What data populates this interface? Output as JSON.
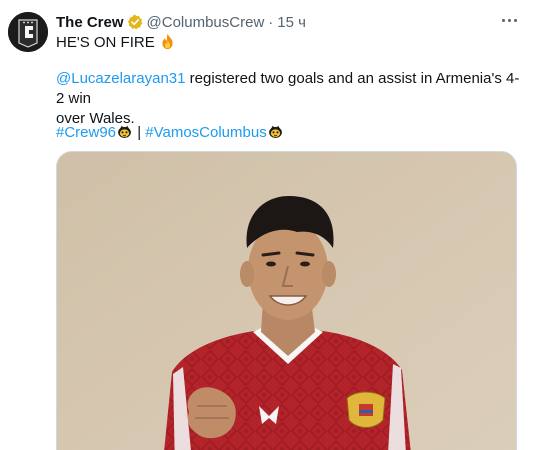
{
  "tweet": {
    "author": {
      "display_name": "The Crew",
      "handle": "@ColumbusCrew",
      "separator": "·",
      "time": "15 ч",
      "verified": true,
      "avatar_letter": "C"
    },
    "line1": "HE'S ON FIRE",
    "mention": "@Lucazelarayan31",
    "body_part1": " registered two goals and an assist in Armenia's 4-2 win",
    "body_part2": "over Wales.",
    "hashtag1": "#Crew96",
    "divider": " | ",
    "hashtag2": "#VamosColumbus",
    "icons": {
      "fire": "fire-emoji",
      "bee": "bee-emoji",
      "more": "more-dots-icon",
      "verified": "verified-badge-icon"
    }
  },
  "colors": {
    "link": "#1d9bf0",
    "text": "#0f1419",
    "muted": "#536471",
    "verified_gold": "#e2b719",
    "jersey_red": "#b3232a"
  }
}
